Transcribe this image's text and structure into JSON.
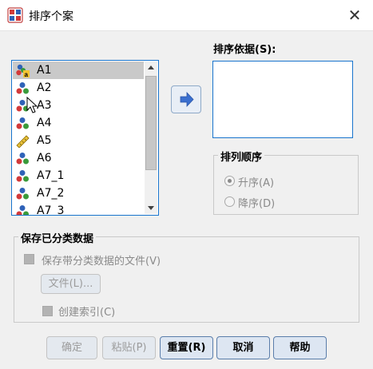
{
  "window": {
    "title": "排序个案",
    "close_symbol": "✕"
  },
  "variables": {
    "scroll_position": 0.0,
    "items": [
      {
        "label": "A1",
        "icon": "nominal-string-icon",
        "selected": true
      },
      {
        "label": "A2",
        "icon": "nominal-icon",
        "selected": false
      },
      {
        "label": "A3",
        "icon": "nominal-icon",
        "selected": false
      },
      {
        "label": "A4",
        "icon": "nominal-icon",
        "selected": false
      },
      {
        "label": "A5",
        "icon": "scale-ruler-icon",
        "selected": false
      },
      {
        "label": "A6",
        "icon": "nominal-icon",
        "selected": false
      },
      {
        "label": "A7_1",
        "icon": "nominal-icon",
        "selected": false
      },
      {
        "label": "A7_2",
        "icon": "nominal-icon",
        "selected": false
      },
      {
        "label": "A7_3",
        "icon": "nominal-icon",
        "selected": false
      }
    ]
  },
  "sort_by": {
    "label": "排序依据(S):",
    "mnemonic": "S",
    "items": []
  },
  "sort_order": {
    "legend": "排列顺序",
    "ascending": {
      "label": "升序(A)",
      "checked": true
    },
    "descending": {
      "label": "降序(D)",
      "checked": false
    }
  },
  "save_sorted": {
    "legend": "保存已分类数据",
    "save_file_checkbox": {
      "label": "保存带分类数据的文件(V)",
      "checked": false
    },
    "file_button": "文件(L)...",
    "create_index_checkbox": {
      "label": "创建索引(C)",
      "checked": false
    }
  },
  "buttons": {
    "ok": "确定",
    "paste": "粘贴(P)",
    "reset": "重置(R)",
    "cancel": "取消",
    "help": "帮助"
  },
  "colors": {
    "accent_border": "#1874cd",
    "arrow_button": "#3a6fcf",
    "disabled_text": "#8a8a8a"
  }
}
